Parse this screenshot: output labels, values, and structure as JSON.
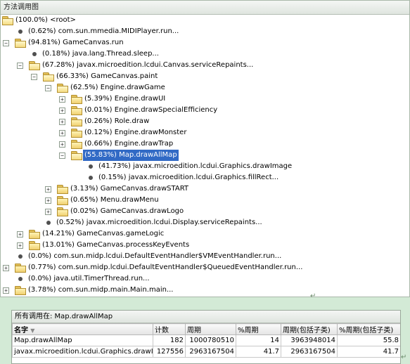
{
  "tree_panel": {
    "title": "方法调用图",
    "rows": [
      {
        "label": "(100.0%) <root>",
        "type": "folder",
        "state": "open"
      },
      {
        "label": "(0.62%) com.sun.mmedia.MIDIPlayer.run...",
        "type": "leaf"
      },
      {
        "label": "(94.81%) GameCanvas.run",
        "type": "folder",
        "state": "open"
      },
      {
        "label": "(0.18%) java.lang.Thread.sleep...",
        "type": "leaf"
      },
      {
        "label": "(67.28%) javax.microedition.lcdui.Canvas.serviceRepaints...",
        "type": "folder",
        "state": "open"
      },
      {
        "label": "(66.33%) GameCanvas.paint",
        "type": "folder",
        "state": "open"
      },
      {
        "label": "(62.5%) Engine.drawGame",
        "type": "folder",
        "state": "open"
      },
      {
        "label": "(5.39%) Engine.drawUI",
        "type": "folder",
        "state": "closed"
      },
      {
        "label": "(0.01%) Engine.drawSpecialEfficiency",
        "type": "folder",
        "state": "closed"
      },
      {
        "label": "(0.26%) Role.draw",
        "type": "folder",
        "state": "closed"
      },
      {
        "label": "(0.12%) Engine.drawMonster",
        "type": "folder",
        "state": "closed"
      },
      {
        "label": "(0.66%) Engine.drawTrap",
        "type": "folder",
        "state": "closed"
      },
      {
        "label": "(55.83%) Map.drawAllMap",
        "type": "folder",
        "state": "open",
        "selected": true
      },
      {
        "label": "(41.73%) javax.microedition.lcdui.Graphics.drawImage",
        "type": "leaf"
      },
      {
        "label": "(0.15%) javax.microedition.lcdui.Graphics.fillRect...",
        "type": "leaf"
      },
      {
        "label": "(3.13%) GameCanvas.drawSTART",
        "type": "folder",
        "state": "closed"
      },
      {
        "label": "(0.65%) Menu.drawMenu",
        "type": "folder",
        "state": "closed"
      },
      {
        "label": "(0.02%) GameCanvas.drawLogo",
        "type": "folder",
        "state": "closed"
      },
      {
        "label": "(0.52%) javax.microedition.lcdui.Display.serviceRepaints...",
        "type": "leaf"
      },
      {
        "label": "(14.21%) GameCanvas.gameLogic",
        "type": "folder",
        "state": "closed"
      },
      {
        "label": "(13.01%) GameCanvas.processKeyEvents",
        "type": "folder",
        "state": "closed"
      },
      {
        "label": "(0.0%) com.sun.midp.lcdui.DefaultEventHandler$VMEventHandler.run...",
        "type": "leaf"
      },
      {
        "label": "(0.77%) com.sun.midp.lcdui.DefaultEventHandler$QueuedEventHandler.run...",
        "type": "folder",
        "state": "closed"
      },
      {
        "label": "(0.0%) java.util.TimerThread.run...",
        "type": "leaf"
      },
      {
        "label": "(3.78%) com.sun.midp.main.Main.main...",
        "type": "folder",
        "state": "closed"
      }
    ]
  },
  "callers_panel": {
    "title": "所有调用在:  Map.drawAllMap",
    "columns": [
      "名字",
      "计数",
      "周期",
      "%周期",
      "周期(包括子类)",
      "%周期(包括子类)"
    ],
    "rows": [
      [
        "Map.drawAllMap",
        "182",
        "1000780510",
        "14",
        "3963948014",
        "55.8"
      ],
      [
        "javax.microedition.lcdui.Graphics.drawIma...",
        "127556",
        "2963167504",
        "41.7",
        "2963167504",
        "41.7"
      ]
    ]
  },
  "paragraph_mark": "↵",
  "expander": {
    "collapsed": "+",
    "expanded": "−"
  },
  "sort_arrow": "▼"
}
